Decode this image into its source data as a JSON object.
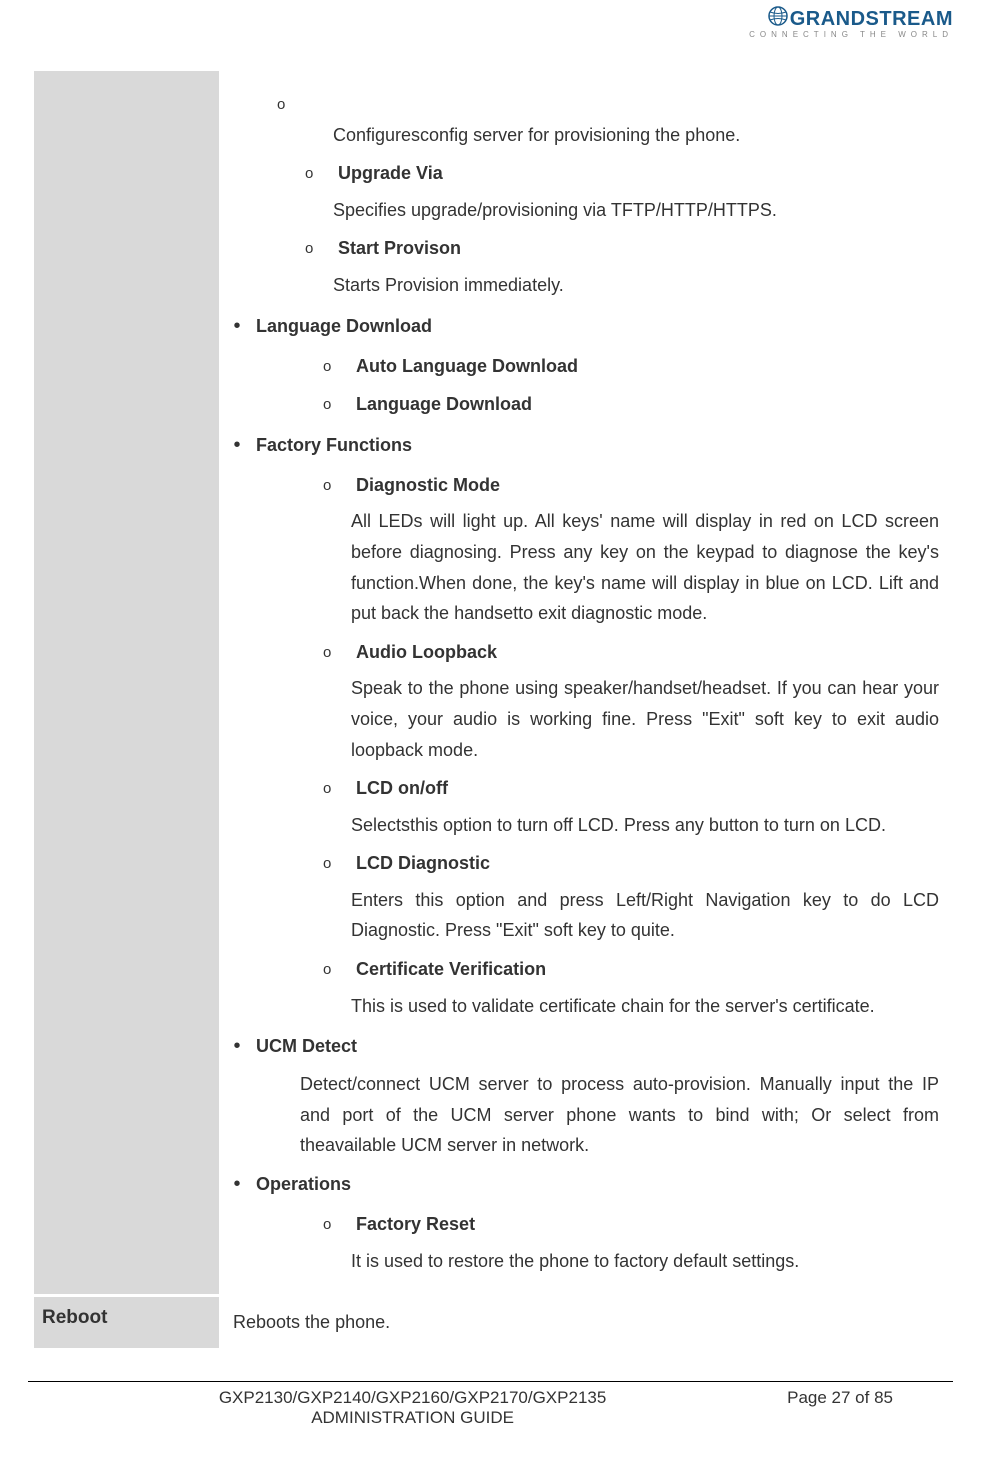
{
  "logo": {
    "brand": "GRANDSTREAM",
    "tagline": "CONNECTING THE WORLD"
  },
  "row1_intro_desc": "Configuresconfig server for provisioning the phone.",
  "sub_upgrade_via": {
    "title": "Upgrade Via",
    "desc": "Specifies upgrade/provisioning via TFTP/HTTP/HTTPS."
  },
  "sub_start_provision": {
    "title": "Start Provison",
    "desc": "Starts Provision immediately."
  },
  "lang_download": {
    "title": "Language Download",
    "sub_auto": "Auto Language Download",
    "sub_lang": "Language Download"
  },
  "factory": {
    "title": "Factory Functions",
    "diag": {
      "title": "Diagnostic Mode",
      "desc": "All LEDs will light up. All keys' name will display in red on LCD screen before diagnosing. Press any key on the keypad to diagnose the key's function.When done, the key's name will display in blue on LCD. Lift and put back the handsetto exit diagnostic mode."
    },
    "audio": {
      "title": "Audio Loopback",
      "desc": "Speak to the phone using speaker/handset/headset. If you can hear your voice, your audio is working fine. Press \"Exit\" soft key to exit audio loopback mode."
    },
    "lcd_onoff": {
      "title": "LCD on/off",
      "desc": "Selectsthis option to turn off LCD. Press any button to turn on LCD."
    },
    "lcd_diag": {
      "title": "LCD Diagnostic",
      "desc": "Enters this option and press Left/Right Navigation key to do LCD Diagnostic. Press \"Exit\" soft key to quite."
    },
    "cert": {
      "title": "Certificate Verification",
      "desc": "This is used to validate certificate chain for the server's certificate."
    }
  },
  "ucm": {
    "title": "UCM Detect",
    "desc": "Detect/connect UCM server to process auto-provision. Manually input the IP and port of the UCM server phone wants to bind with; Or select from theavailable UCM server in network."
  },
  "operations": {
    "title": "Operations",
    "factory_reset": {
      "title": "Factory Reset",
      "desc": "It is used to restore the phone to factory default settings."
    }
  },
  "reboot": {
    "label": "Reboot",
    "desc": "Reboots the phone."
  },
  "footer": {
    "title_line1": "GXP2130/GXP2140/GXP2160/GXP2170/GXP2135",
    "title_line2": "ADMINISTRATION GUIDE",
    "page": "Page 27 of 85"
  }
}
